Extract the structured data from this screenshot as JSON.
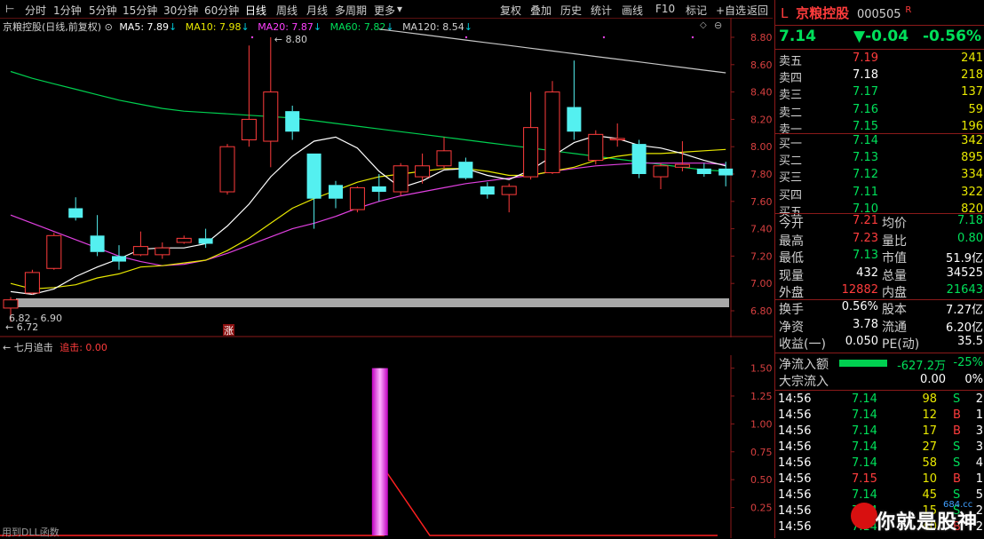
{
  "toolbar": {
    "periods": [
      "分时",
      "1分钟",
      "5分钟",
      "15分钟",
      "30分钟",
      "60分钟",
      "日线",
      "周线",
      "月线",
      "多周期",
      "更多"
    ],
    "active_period": "日线",
    "more_arrow": "▾",
    "actions": [
      "复权",
      "叠加",
      "历史",
      "统计",
      "画线",
      "F10",
      "标记",
      "+自选",
      "返回"
    ]
  },
  "chart_header": {
    "title": "京粮控股(日线,前复权)",
    "ma5": "MA5: 7.89",
    "ma10": "MA10: 7.98",
    "ma20": "MA20: 7.87",
    "ma60": "MA60: 7.82",
    "ma120": "MA120: 8.54",
    "arrow": "↓"
  },
  "price_axis": {
    "ticks": [
      "8.80",
      "8.60",
      "8.40",
      "8.20",
      "8.00",
      "7.80",
      "7.60",
      "7.40",
      "7.20",
      "7.00",
      "6.80"
    ]
  },
  "annotations": {
    "high": "8.80",
    "low": "6.72",
    "range": "6.82 - 6.90",
    "zhang": "涨"
  },
  "indicator": {
    "name": "七月追击",
    "series": "追击: 0.00",
    "ticks": [
      "1.50",
      "1.25",
      "1.00",
      "0.75",
      "0.50",
      "0.25"
    ],
    "footer": "用到DLL函数"
  },
  "chart_data": {
    "type": "candlestick",
    "ylim": [
      6.7,
      8.9
    ],
    "candles": [
      {
        "o": 6.82,
        "c": 6.88,
        "h": 6.9,
        "l": 6.72
      },
      {
        "o": 6.93,
        "c": 7.08,
        "h": 7.1,
        "l": 6.92
      },
      {
        "o": 7.11,
        "c": 7.35,
        "h": 7.37,
        "l": 7.1
      },
      {
        "o": 7.55,
        "c": 7.48,
        "h": 7.63,
        "l": 7.46
      },
      {
        "o": 7.35,
        "c": 7.23,
        "h": 7.5,
        "l": 7.2
      },
      {
        "o": 7.2,
        "c": 7.16,
        "h": 7.28,
        "l": 7.1
      },
      {
        "o": 7.21,
        "c": 7.27,
        "h": 7.38,
        "l": 7.2
      },
      {
        "o": 7.21,
        "c": 7.26,
        "h": 7.3,
        "l": 7.18
      },
      {
        "o": 7.3,
        "c": 7.33,
        "h": 7.35,
        "l": 7.29
      },
      {
        "o": 7.33,
        "c": 7.29,
        "h": 7.4,
        "l": 7.26
      },
      {
        "o": 7.67,
        "c": 8.0,
        "h": 8.02,
        "l": 7.65
      },
      {
        "o": 8.05,
        "c": 8.2,
        "h": 8.74,
        "l": 8.0
      },
      {
        "o": 8.04,
        "c": 8.4,
        "h": 8.8,
        "l": 7.85
      },
      {
        "o": 8.26,
        "c": 8.11,
        "h": 8.3,
        "l": 8.05
      },
      {
        "o": 7.95,
        "c": 7.62,
        "h": 7.95,
        "l": 7.4
      },
      {
        "o": 7.72,
        "c": 7.62,
        "h": 7.75,
        "l": 7.55
      },
      {
        "o": 7.54,
        "c": 7.7,
        "h": 7.71,
        "l": 7.52
      },
      {
        "o": 7.71,
        "c": 7.67,
        "h": 7.8,
        "l": 7.6
      },
      {
        "o": 7.67,
        "c": 7.86,
        "h": 7.88,
        "l": 7.64
      },
      {
        "o": 7.78,
        "c": 7.86,
        "h": 7.95,
        "l": 7.73
      },
      {
        "o": 7.86,
        "c": 7.97,
        "h": 8.07,
        "l": 7.84
      },
      {
        "o": 7.89,
        "c": 7.77,
        "h": 7.92,
        "l": 7.76
      },
      {
        "o": 7.71,
        "c": 7.65,
        "h": 7.74,
        "l": 7.62
      },
      {
        "o": 7.65,
        "c": 7.71,
        "h": 7.73,
        "l": 7.52
      },
      {
        "o": 7.78,
        "c": 8.14,
        "h": 8.4,
        "l": 7.76
      },
      {
        "o": 7.81,
        "c": 8.4,
        "h": 8.48,
        "l": 7.8
      },
      {
        "o": 8.29,
        "c": 8.11,
        "h": 8.63,
        "l": 8.05
      },
      {
        "o": 7.9,
        "c": 8.09,
        "h": 8.12,
        "l": 7.87
      },
      {
        "o": 8.05,
        "c": 8.06,
        "h": 8.17,
        "l": 8.0
      },
      {
        "o": 8.02,
        "c": 7.8,
        "h": 8.05,
        "l": 7.77
      },
      {
        "o": 7.78,
        "c": 7.86,
        "h": 7.88,
        "l": 7.69
      },
      {
        "o": 7.85,
        "c": 7.87,
        "h": 8.04,
        "l": 7.82
      },
      {
        "o": 7.84,
        "c": 7.8,
        "h": 7.88,
        "l": 7.78
      },
      {
        "o": 7.84,
        "c": 7.79,
        "h": 7.89,
        "l": 7.71
      }
    ],
    "ma5": [
      6.94,
      6.92,
      6.96,
      7.05,
      7.12,
      7.18,
      7.25,
      7.26,
      7.26,
      7.29,
      7.42,
      7.58,
      7.78,
      7.93,
      8.04,
      8.07,
      7.99,
      7.82,
      7.7,
      7.75,
      7.83,
      7.84,
      7.79,
      7.76,
      7.83,
      7.93,
      8.03,
      8.08,
      8.06,
      8.01,
      7.99,
      7.95,
      7.9,
      7.86
    ],
    "ma10": [
      7.0,
      6.96,
      6.97,
      6.99,
      7.04,
      7.07,
      7.12,
      7.13,
      7.15,
      7.17,
      7.24,
      7.33,
      7.44,
      7.55,
      7.62,
      7.68,
      7.74,
      7.78,
      7.8,
      7.82,
      7.84,
      7.84,
      7.82,
      7.79,
      7.79,
      7.82,
      7.85,
      7.9,
      7.93,
      7.95,
      7.95,
      7.96,
      7.97,
      7.98
    ],
    "ma20": [
      7.5,
      7.44,
      7.38,
      7.32,
      7.26,
      7.2,
      7.16,
      7.13,
      7.14,
      7.17,
      7.22,
      7.28,
      7.34,
      7.4,
      7.44,
      7.49,
      7.55,
      7.6,
      7.64,
      7.67,
      7.7,
      7.73,
      7.75,
      7.77,
      7.79,
      7.82,
      7.84,
      7.86,
      7.87,
      7.88,
      7.88,
      7.88,
      7.88,
      7.87
    ],
    "ma60": [
      8.55,
      8.5,
      8.46,
      8.42,
      8.38,
      8.34,
      8.31,
      8.28,
      8.26,
      8.25,
      8.24,
      8.23,
      8.22,
      8.21,
      8.19,
      8.17,
      8.15,
      8.13,
      8.11,
      8.09,
      8.07,
      8.05,
      8.03,
      8.01,
      7.99,
      7.97,
      7.95,
      7.93,
      7.91,
      7.89,
      7.87,
      7.85,
      7.83,
      7.82
    ],
    "ma120_tail": [
      8.86,
      8.84,
      8.82,
      8.8,
      8.78,
      8.76,
      8.74,
      8.72,
      8.7,
      8.68,
      8.66,
      8.64,
      8.62,
      8.6,
      8.58,
      8.56,
      8.54
    ],
    "indicator_ylim": [
      0,
      1.6
    ],
    "indicator_bar_index": 17,
    "indicator_bar_value": 1.5
  },
  "quote": {
    "prefix": "L",
    "name": "京粮控股",
    "code": "000505",
    "flag": "R",
    "price": "7.14",
    "change": "▼-0.04",
    "pct": "-0.56%",
    "asks": [
      {
        "label": "卖五",
        "price": "7.19",
        "vol": "241",
        "cls": "red"
      },
      {
        "label": "卖四",
        "price": "7.18",
        "vol": "218",
        "cls": "white"
      },
      {
        "label": "卖三",
        "price": "7.17",
        "vol": "137",
        "cls": "green"
      },
      {
        "label": "卖二",
        "price": "7.16",
        "vol": "59",
        "cls": "green"
      },
      {
        "label": "卖一",
        "price": "7.15",
        "vol": "196",
        "cls": "green"
      }
    ],
    "bids": [
      {
        "label": "买一",
        "price": "7.14",
        "vol": "342",
        "cls": "green"
      },
      {
        "label": "买二",
        "price": "7.13",
        "vol": "895",
        "cls": "green"
      },
      {
        "label": "买三",
        "price": "7.12",
        "vol": "334",
        "cls": "green"
      },
      {
        "label": "买四",
        "price": "7.11",
        "vol": "322",
        "cls": "green"
      },
      {
        "label": "买五",
        "price": "7.10",
        "vol": "820",
        "cls": "green"
      }
    ],
    "stats": [
      [
        {
          "l": "今开",
          "v": "7.21",
          "c": "red"
        },
        {
          "l": "均价",
          "v": "7.18",
          "c": "green"
        }
      ],
      [
        {
          "l": "最高",
          "v": "7.23",
          "c": "red"
        },
        {
          "l": "量比",
          "v": "0.80",
          "c": "green"
        }
      ],
      [
        {
          "l": "最低",
          "v": "7.13",
          "c": "green"
        },
        {
          "l": "市值",
          "v": "51.9亿",
          "c": "white"
        }
      ],
      [
        {
          "l": "现量",
          "v": "432",
          "c": "white"
        },
        {
          "l": "总量",
          "v": "34525",
          "c": "white"
        }
      ],
      [
        {
          "l": "外盘",
          "v": "12882",
          "c": "red"
        },
        {
          "l": "内盘",
          "v": "21643",
          "c": "green"
        }
      ]
    ],
    "fundamentals": [
      [
        {
          "l": "换手",
          "v": "0.56%",
          "c": "white"
        },
        {
          "l": "股本",
          "v": "7.27亿",
          "c": "white"
        }
      ],
      [
        {
          "l": "净资",
          "v": "3.78",
          "c": "white"
        },
        {
          "l": "流通",
          "v": "6.20亿",
          "c": "white"
        }
      ],
      [
        {
          "l": "收益(一)",
          "v": "0.050",
          "c": "white"
        },
        {
          "l": "PE(动)",
          "v": "35.5",
          "c": "white"
        }
      ]
    ],
    "flow": {
      "net_label": "净流入额",
      "net_value": "-627.2万",
      "net_pct": "-25%",
      "big_label": "大宗流入",
      "big_value": "0.00",
      "big_pct": "0%",
      "net_bar_fraction": 0.25
    },
    "ticks": [
      {
        "t": "14:56",
        "p": "7.14",
        "v": "98",
        "s": "S",
        "n": "2"
      },
      {
        "t": "14:56",
        "p": "7.14",
        "v": "12",
        "s": "B",
        "n": "1"
      },
      {
        "t": "14:56",
        "p": "7.14",
        "v": "17",
        "s": "B",
        "n": "3"
      },
      {
        "t": "14:56",
        "p": "7.14",
        "v": "27",
        "s": "S",
        "n": "3"
      },
      {
        "t": "14:56",
        "p": "7.14",
        "v": "58",
        "s": "S",
        "n": "4"
      },
      {
        "t": "14:56",
        "p": "7.15",
        "v": "10",
        "s": "B",
        "n": "1"
      },
      {
        "t": "14:56",
        "p": "7.14",
        "v": "45",
        "s": "S",
        "n": "5"
      },
      {
        "t": "14:56",
        "p": "7.14",
        "v": "15",
        "s": "S",
        "n": "2"
      },
      {
        "t": "14:56",
        "p": "7.14",
        "v": "40",
        "s": "B",
        "n": "2"
      }
    ]
  },
  "watermark": {
    "brand": "你就是股神",
    "site": "684.cc"
  }
}
